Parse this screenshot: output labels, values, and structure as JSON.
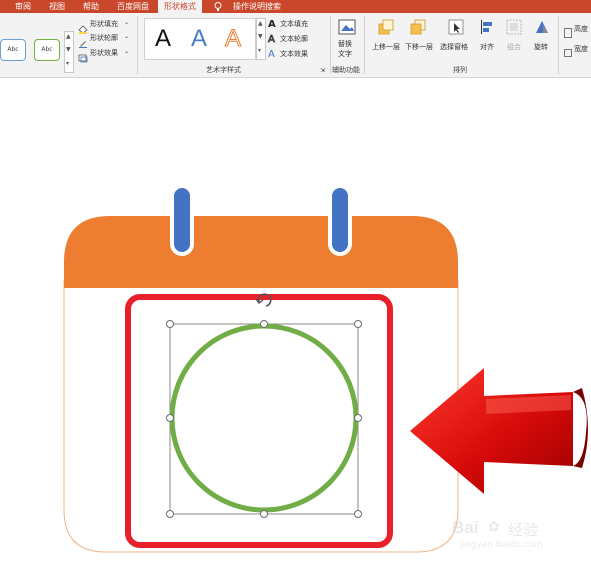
{
  "tabs": [
    {
      "label": "审阅",
      "active": false
    },
    {
      "label": "视图",
      "active": false
    },
    {
      "label": "帮助",
      "active": false
    },
    {
      "label": "百度网盘",
      "active": false
    },
    {
      "label": "形状格式",
      "active": true
    },
    {
      "label": "操作说明搜索",
      "active": false
    }
  ],
  "ribbon": {
    "shape_styles": {
      "presets": [
        "Abc",
        "Abc"
      ],
      "fill": "形状填充",
      "outline": "形状轮廓",
      "effects": "形状效果"
    },
    "wordart": {
      "letters": [
        "A",
        "A",
        "A"
      ],
      "text_fill": "文本填充",
      "text_outline": "文本轮廓",
      "text_effects": "文本效果",
      "group_label": "艺术字样式"
    },
    "accessibility": {
      "alt_text_line1": "替换",
      "alt_text_line2": "文字",
      "group_label": "辅助功能"
    },
    "arrange": {
      "bring_forward": "上移一层",
      "send_backward": "下移一层",
      "selection_pane": "选择窗格",
      "align": "对齐",
      "group": "组合",
      "rotate": "旋转",
      "group_label": "排列"
    },
    "size": {
      "height": "高度",
      "width": "宽度"
    }
  },
  "watermark": {
    "brand": "Bai",
    "brand_cn": "经验",
    "url": "jingyan.baidu.com"
  },
  "colors": {
    "accent": "#c9472b",
    "calendar_orange": "#ed7d31",
    "ring_blue": "#4472c4",
    "circle_green": "#70ad47",
    "highlight_red": "#e8202a"
  }
}
